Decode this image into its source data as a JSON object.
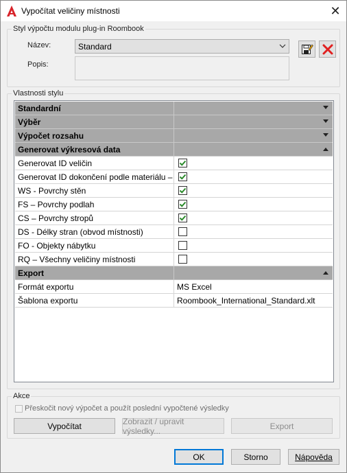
{
  "window": {
    "title": "Vypočítat veličiny místnosti",
    "close_glyph": "✕"
  },
  "style_group": {
    "label": "Styl výpočtu modulu plug-in Roombook",
    "name_label": "Název:",
    "name_value": "Standard",
    "desc_label": "Popis:",
    "desc_value": ""
  },
  "properties": {
    "label": "Vlastnosti stylu",
    "rows": [
      {
        "type": "category",
        "label": "Standardní",
        "state": "collapsed"
      },
      {
        "type": "category",
        "label": "Výběr",
        "state": "collapsed"
      },
      {
        "type": "category",
        "label": "Výpočet rozsahu",
        "state": "collapsed"
      },
      {
        "type": "category",
        "label": "Generovat výkresová data",
        "state": "expanded"
      },
      {
        "type": "check",
        "label": "Generovat ID veličin",
        "checked": true
      },
      {
        "type": "check",
        "label": "Generovat ID dokončení podle materiálu –",
        "checked": true
      },
      {
        "type": "check",
        "label": "WS - Povrchy stěn",
        "checked": true
      },
      {
        "type": "check",
        "label": "FS – Povrchy podlah",
        "checked": true
      },
      {
        "type": "check",
        "label": "CS – Povrchy stropů",
        "checked": true
      },
      {
        "type": "check",
        "label": "DS - Délky stran (obvod místnosti)",
        "checked": false
      },
      {
        "type": "check",
        "label": "FO - Objekty nábytku",
        "checked": false
      },
      {
        "type": "check",
        "label": "RQ – Všechny veličiny místnosti",
        "checked": false
      },
      {
        "type": "category",
        "label": "Export",
        "state": "expanded"
      },
      {
        "type": "text",
        "label": "Formát exportu",
        "value": "MS Excel"
      },
      {
        "type": "text",
        "label": "Šablona exportu",
        "value": "Roombook_International_Standard.xlt"
      }
    ]
  },
  "actions": {
    "label": "Akce",
    "skip_label": "Přeskočit nový výpočet a použít poslední vypočtené výsledky",
    "skip_checked": false,
    "calculate": "Vypočítat",
    "view_edit": "Zobrazit / upravit výsledky...",
    "export": "Export"
  },
  "footer": {
    "ok": "OK",
    "cancel": "Storno",
    "help": "Nápověda"
  },
  "colors": {
    "check_green": "#2a8a2a",
    "delete_red": "#e02020",
    "category_bg": "#a8a8a8",
    "default_button_border": "#0078d7"
  }
}
